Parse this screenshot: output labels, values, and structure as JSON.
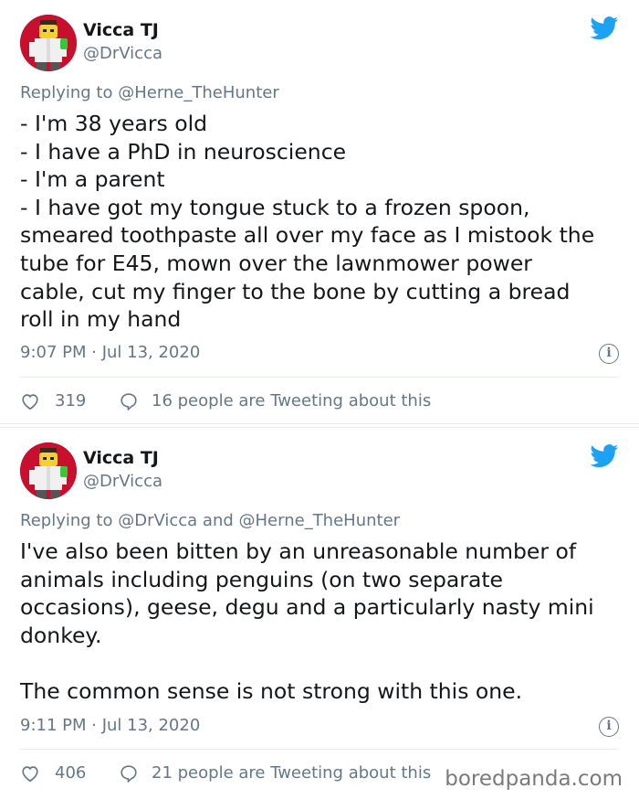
{
  "tweets": [
    {
      "name": "Vicca TJ",
      "handle": "@DrVicca",
      "reply_prefix": "Replying to ",
      "reply_targets": "@Herne_TheHunter",
      "lines": [
        "- I'm 38 years old",
        "- I have a PhD in neuroscience",
        "- I'm a parent",
        "- I have got my tongue stuck to a frozen spoon,",
        "smeared toothpaste all over my face as I mistook the",
        "tube for E45, mown over the lawnmower power",
        "cable, cut my finger to the bone by cutting a bread",
        "roll in my hand"
      ],
      "timestamp": "9:07 PM · Jul 13, 2020",
      "likes": "319",
      "talking": "16 people are Tweeting about this"
    },
    {
      "name": "Vicca TJ",
      "handle": "@DrVicca",
      "reply_prefix": "Replying to ",
      "reply_targets": "@DrVicca and @Herne_TheHunter",
      "lines": [
        "I've also been bitten by an unreasonable number of",
        "animals including penguins (on two separate",
        "occasions), geese, degu and a particularly nasty mini",
        "donkey.",
        "",
        "The common sense is not strong with this one."
      ],
      "timestamp": "9:11 PM · Jul 13, 2020",
      "likes": "406",
      "talking": "21 people are Tweeting about this"
    }
  ],
  "watermark": "boredpanda.com",
  "icons": {
    "info": "i",
    "bird": "twitter-bird-icon",
    "like": "heart-icon",
    "reply": "speech-bubble-icon"
  },
  "colors": {
    "twitter_blue": "#1da1f2",
    "secondary_text": "#657786",
    "primary_text": "#14171a"
  }
}
